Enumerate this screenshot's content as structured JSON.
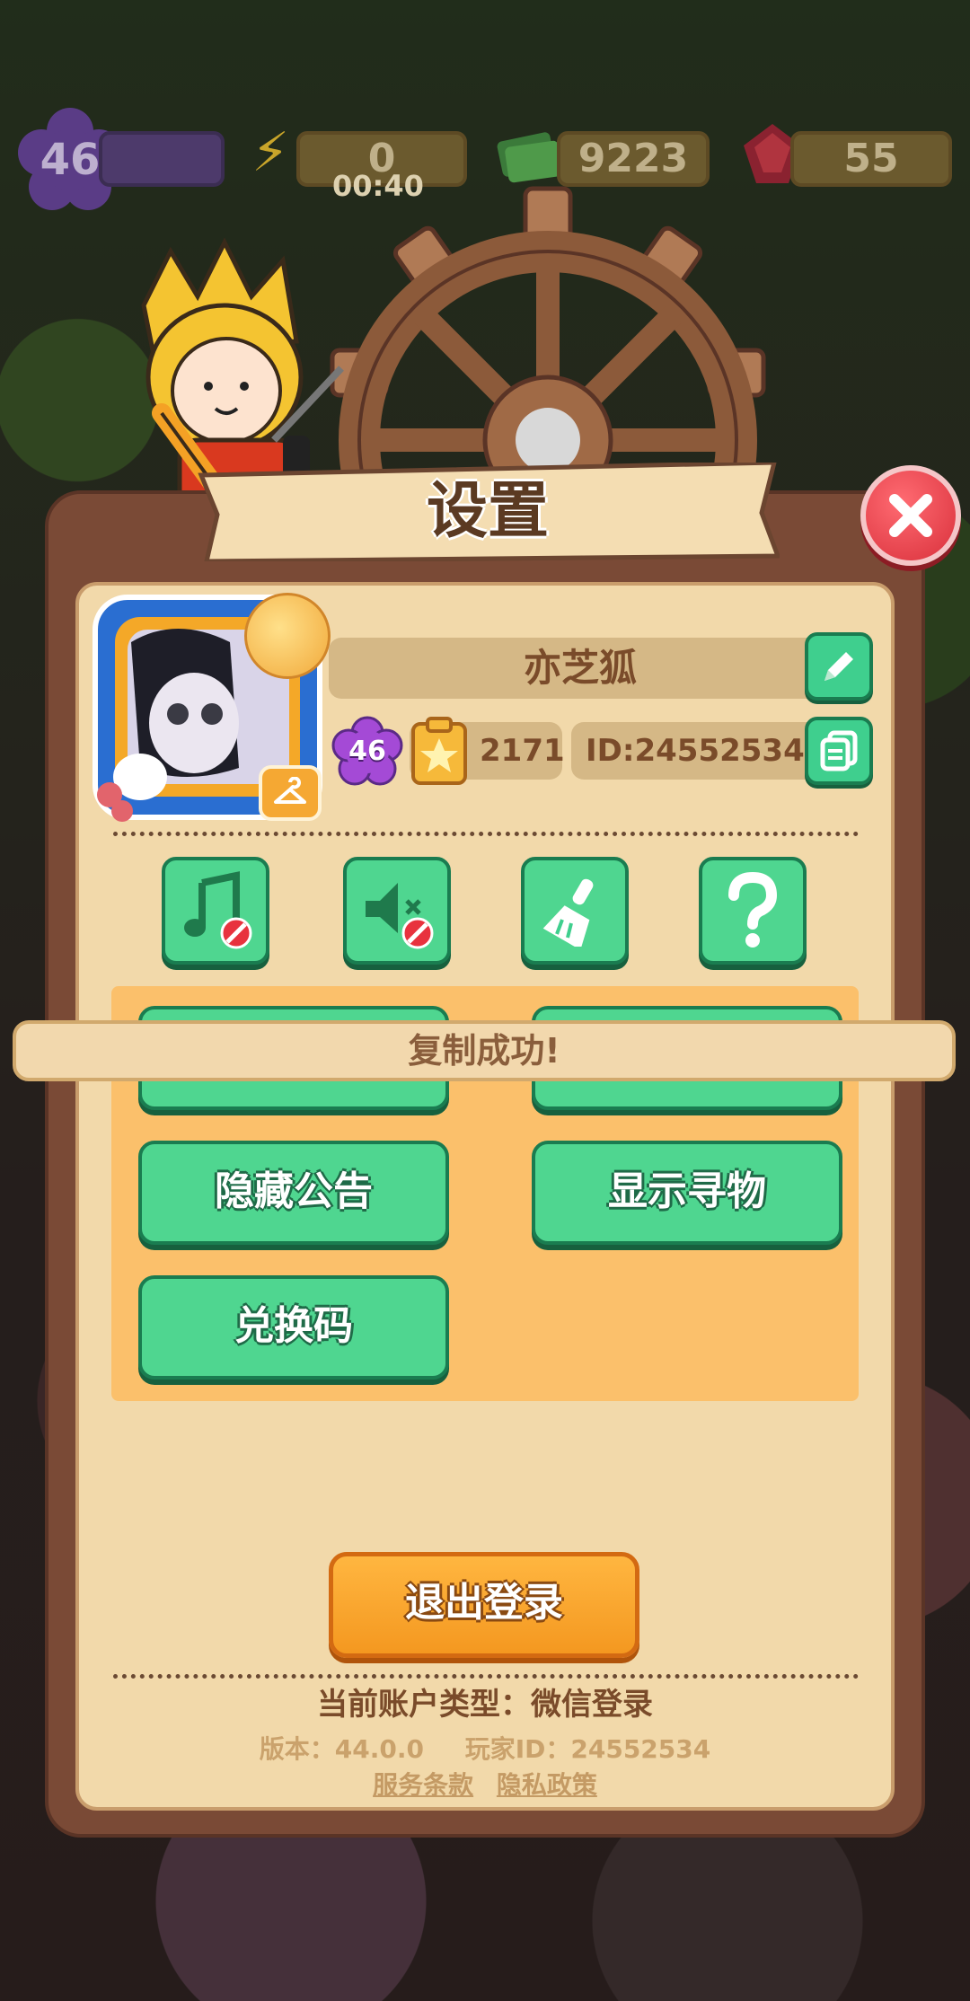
{
  "hud": {
    "level": "46",
    "energy": "0",
    "energy_timer": "00:40",
    "cash": "9223",
    "gems": "55"
  },
  "panel": {
    "title": "设置"
  },
  "profile": {
    "name": "亦芝狐",
    "level": "46",
    "score": "2171",
    "id_label": "ID:24552534"
  },
  "options": [
    {
      "name": "music-off"
    },
    {
      "name": "sound-off"
    },
    {
      "name": "clear-cache"
    },
    {
      "name": "help"
    }
  ],
  "buttons": {
    "hide_notice": "隐藏公告",
    "show_find": "显示寻物",
    "redeem_code": "兑换码",
    "logout": "退出登录"
  },
  "toast": "复制成功!",
  "footer": {
    "account_type": "当前账户类型：微信登录",
    "version": "版本：44.0.0",
    "player_id": "玩家ID：24552534",
    "terms": "服务条款",
    "privacy": "隐私政策"
  },
  "colors": {
    "accent_green": "#4fd690",
    "panel_bg": "#f2d9aa",
    "orange": "#fbc06b",
    "close_red": "#d9303b"
  }
}
